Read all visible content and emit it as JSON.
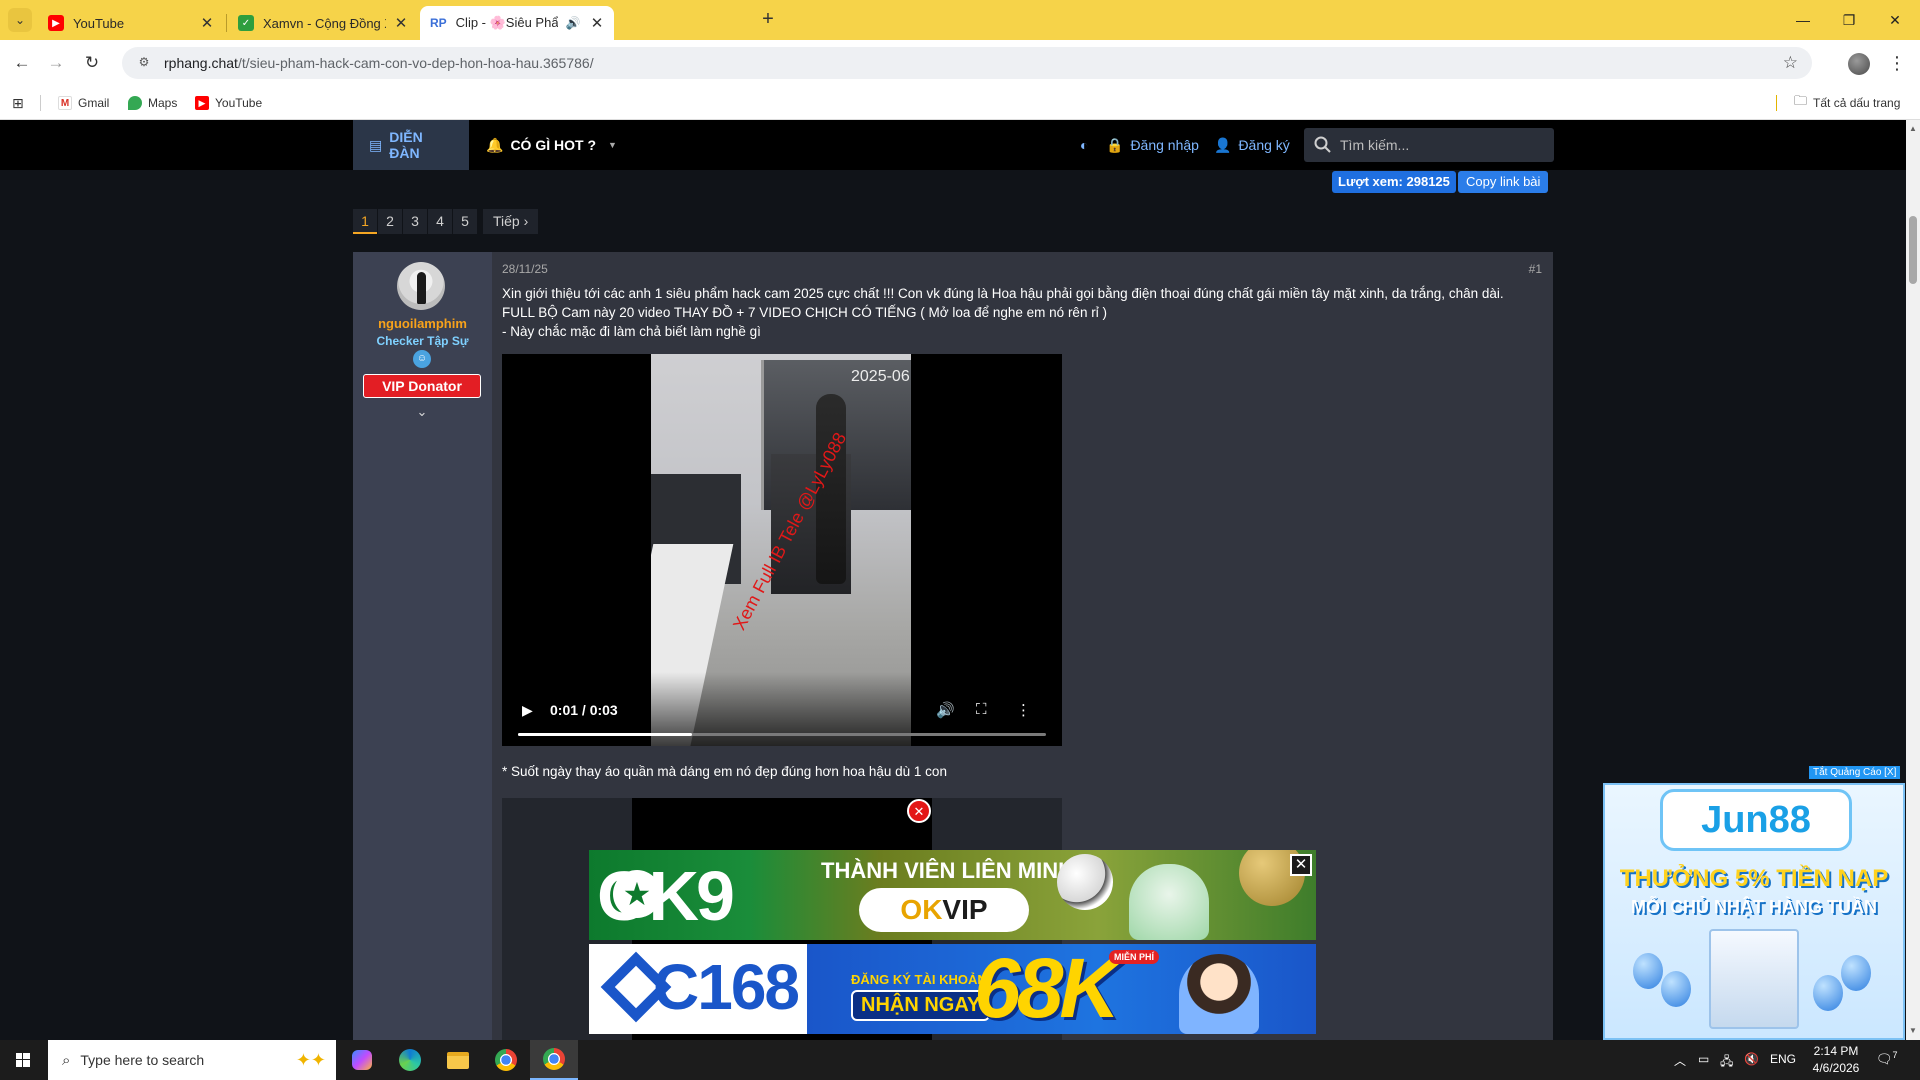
{
  "browser": {
    "tabs": [
      {
        "title": "YouTube",
        "favicon": "youtube-icon",
        "color": "#ff0000",
        "active": false
      },
      {
        "title": "Xamvn - Cộng Đồng Xe Ôm",
        "favicon": "checkmark-icon",
        "color": "#2e9e3e",
        "active": false
      },
      {
        "title": "Clip - 🌸Siêu Phẩm Hack C",
        "favicon_text": "RP",
        "favicon": "rp-icon",
        "color": "#3b6fd8",
        "active": true
      }
    ],
    "url_host": "rphang.chat",
    "url_path": "/t/sieu-pham-hack-cam-con-vo-dep-hon-hoa-hau.365786/",
    "bookmarks": [
      {
        "label": "Gmail",
        "icon": "gmail-icon"
      },
      {
        "label": "Maps",
        "icon": "maps-icon"
      },
      {
        "label": "YouTube",
        "icon": "youtube-icon"
      }
    ],
    "all_bookmarks": "Tất cả dấu trang"
  },
  "forum_nav": {
    "forum": "DIỄN ĐÀN",
    "hot": "CÓ GÌ HOT ?",
    "login": "Đăng nhập",
    "register": "Đăng ký",
    "search_placeholder": "Tìm kiếm..."
  },
  "thread_stats": {
    "views": "Lượt xem: 298125",
    "copy_link": "Copy link bài"
  },
  "pagination": {
    "pages": [
      "1",
      "2",
      "3",
      "4",
      "5"
    ],
    "current": "1",
    "next": "Tiếp ›"
  },
  "post": {
    "username": "nguoilamphim",
    "user_title": "Checker Tập Sự",
    "vip_label": "VIP Donator",
    "date": "28/11/25",
    "number": "#1",
    "line1": "Xin giới thiệu tới các anh 1 siêu phẩm hack cam 2025 cực chất !!! Con vk đúng là Hoa hậu phải gọi bằng điện thoại đúng chất gái miền tây mặt xinh, da trắng, chân dài.",
    "line2": "FULL BỘ Cam này 20 video THAY ĐỒ + 7 VIDEO CHỊCH CÓ TIẾNG ( Mở loa để nghe em nó rên rỉ )",
    "line3": "- Này chắc mặc đi làm chả biết làm nghề gì",
    "video": {
      "timestamp_overlay": "2025-06",
      "watermark": "Xem Full IB Tele @LyLy088",
      "time": "0:01 / 0:03",
      "progress": 0.33
    },
    "line4": "* Suốt ngày thay áo quần mà dáng em nó đẹp đúng hơn hoa hậu dù 1 con"
  },
  "ads": {
    "ok9_logo": "OK9",
    "ok9_line": "THÀNH VIÊN LIÊN MINH",
    "okvip_prefix": "OK",
    "okvip_suffix": "VIP",
    "c168_logo": "C168",
    "c168_reg": "ĐĂNG KÝ TÀI KHOẢN",
    "c168_now": "NHẬN NGAY",
    "c168_big": "68K",
    "c168_free": "MIỄN PHÍ",
    "side_label": "Tắt Quảng Cáo [X]",
    "jun88_logo": "Jun88",
    "jun88_l1": "THƯỞNG 5% TIỀN NẠP",
    "jun88_l2": "MỖI CHỦ NHẬT HÀNG TUẦN"
  },
  "taskbar": {
    "search_placeholder": "Type here to search",
    "lang": "ENG",
    "time": "2:14 PM",
    "date": "4/6/2026",
    "notif_count": "7"
  }
}
